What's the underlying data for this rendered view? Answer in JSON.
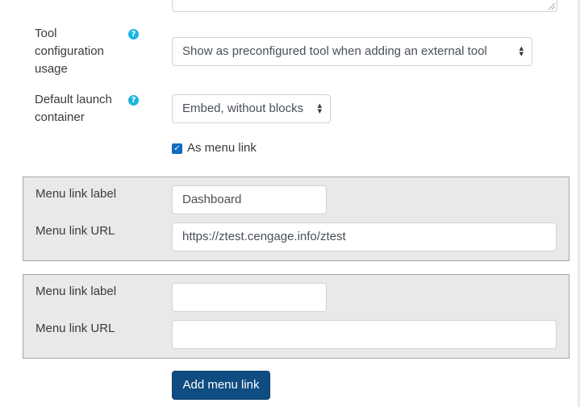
{
  "form": {
    "tool_config_usage": {
      "label_line1": "Tool",
      "label_line2": "configuration",
      "label_line3": "usage",
      "selected": "Show as preconfigured tool when adding an external tool"
    },
    "default_launch_container": {
      "label_line1": "Default launch",
      "label_line2": "container",
      "selected": "Embed, without blocks"
    },
    "as_menu_link": {
      "label": "As menu link",
      "checked": true
    },
    "menu_links": [
      {
        "label_caption": "Menu link label",
        "label_value": "Dashboard",
        "url_caption": "Menu link URL",
        "url_value": "https://ztest.cengage.info/ztest"
      },
      {
        "label_caption": "Menu link label",
        "label_value": "",
        "url_caption": "Menu link URL",
        "url_value": ""
      }
    ],
    "add_menu_link_label": "Add menu link"
  },
  "icons": {
    "help": "question-circle-icon",
    "select_caret": "sort-caret-icon",
    "checkbox": "check-icon"
  },
  "colors": {
    "primary_button": "#0f4c81",
    "help_icon": "#1cb5e0",
    "checkbox": "#0f6cbf",
    "fieldset_bg": "#e9e9e9"
  }
}
